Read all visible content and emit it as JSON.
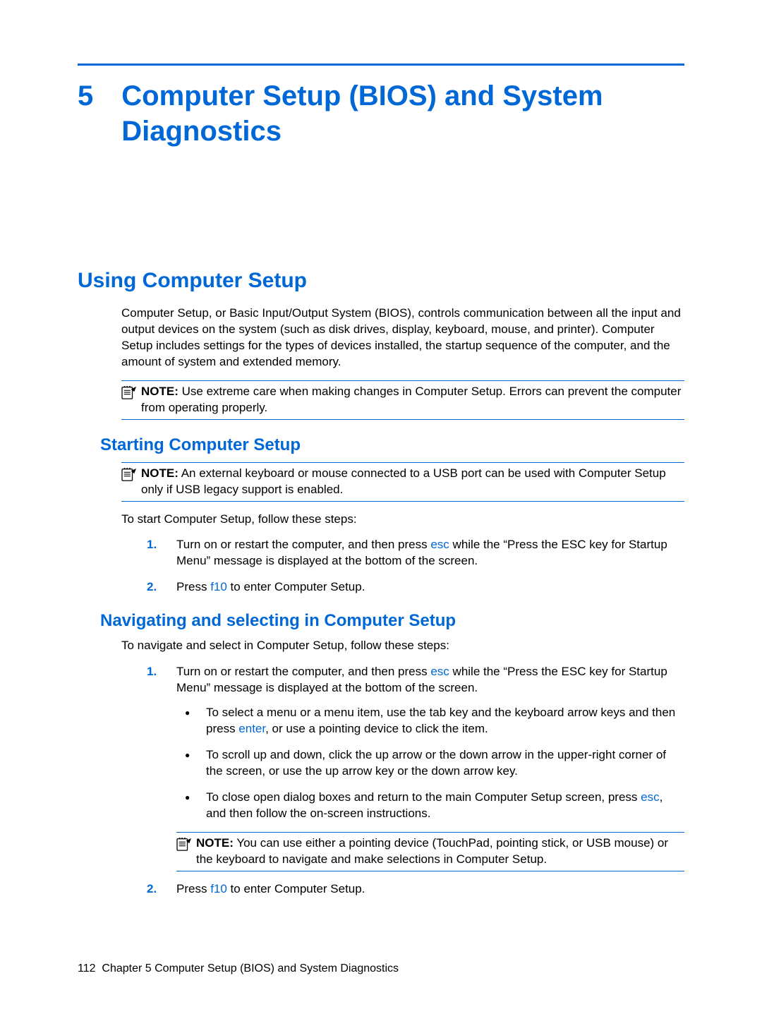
{
  "chapter": {
    "number": "5",
    "title": "Computer Setup (BIOS) and System Diagnostics"
  },
  "section1": {
    "heading": "Using Computer Setup",
    "para": "Computer Setup, or Basic Input/Output System (BIOS), controls communication between all the input and output devices on the system (such as disk drives, display, keyboard, mouse, and printer). Computer Setup includes settings for the types of devices installed, the startup sequence of the computer, and the amount of system and extended memory.",
    "note_label": "NOTE:",
    "note_text": "Use extreme care when making changes in Computer Setup. Errors can prevent the computer from operating properly."
  },
  "section2": {
    "heading": "Starting Computer Setup",
    "note_label": "NOTE:",
    "note_text": "An external keyboard or mouse connected to a USB port can be used with Computer Setup only if USB legacy support is enabled.",
    "intro": "To start Computer Setup, follow these steps:",
    "step1_pre": "Turn on or restart the computer, and then press ",
    "step1_key": "esc",
    "step1_post": " while the “Press the ESC key for Startup Menu” message is displayed at the bottom of the screen.",
    "step2_pre": "Press ",
    "step2_key": "f10",
    "step2_post": " to enter Computer Setup."
  },
  "section3": {
    "heading": "Navigating and selecting in Computer Setup",
    "intro": "To navigate and select in Computer Setup, follow these steps:",
    "step1_pre": "Turn on or restart the computer, and then press ",
    "step1_key": "esc",
    "step1_post": " while the “Press the ESC key for Startup Menu” message is displayed at the bottom of the screen.",
    "b1_pre": "To select a menu or a menu item, use the tab key and the keyboard arrow keys and then press ",
    "b1_key": "enter",
    "b1_post": ", or use a pointing device to click the item.",
    "b2": "To scroll up and down, click the up arrow or the down arrow in the upper-right corner of the screen, or use the up arrow key or the down arrow key.",
    "b3_pre": "To close open dialog boxes and return to the main Computer Setup screen, press ",
    "b3_key": "esc",
    "b3_post": ", and then follow the on-screen instructions.",
    "note_label": "NOTE:",
    "note_text": "You can use either a pointing device (TouchPad, pointing stick, or USB mouse) or the keyboard to navigate and make selections in Computer Setup.",
    "step2_pre": "Press ",
    "step2_key": "f10",
    "step2_post": " to enter Computer Setup."
  },
  "footer": {
    "page": "112",
    "label": "Chapter 5   Computer Setup (BIOS) and System Diagnostics"
  }
}
